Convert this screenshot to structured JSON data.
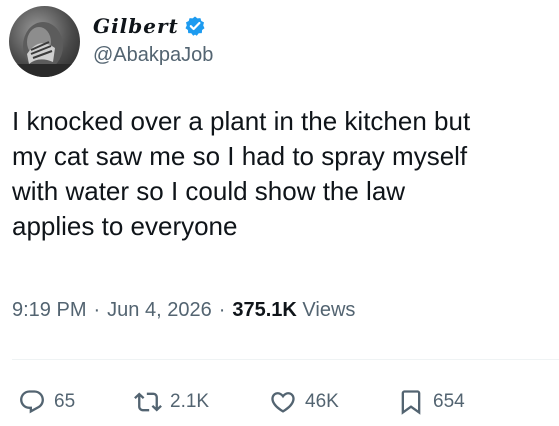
{
  "author": {
    "display_name": "Gilbert",
    "handle": "@AbakpaJob",
    "verified": true,
    "avatar_icon": "avatar-photo"
  },
  "tweet": {
    "text": "I knocked over a plant in the kitchen but\nmy cat saw me so I had to spray myself\nwith water so I could show the law\napplies to everyone"
  },
  "meta": {
    "time": "9:19 PM",
    "separator": "·",
    "date": "Jun 4, 2026",
    "views_count": "375.1K",
    "views_label": "Views"
  },
  "actions": {
    "reply_count": "65",
    "retweet_count": "2.1K",
    "like_count": "46K",
    "bookmark_count": "654"
  },
  "colors": {
    "text": "#0f1419",
    "secondary": "#536471",
    "verified": "#1d9bf0",
    "divider": "#eff3f4"
  }
}
